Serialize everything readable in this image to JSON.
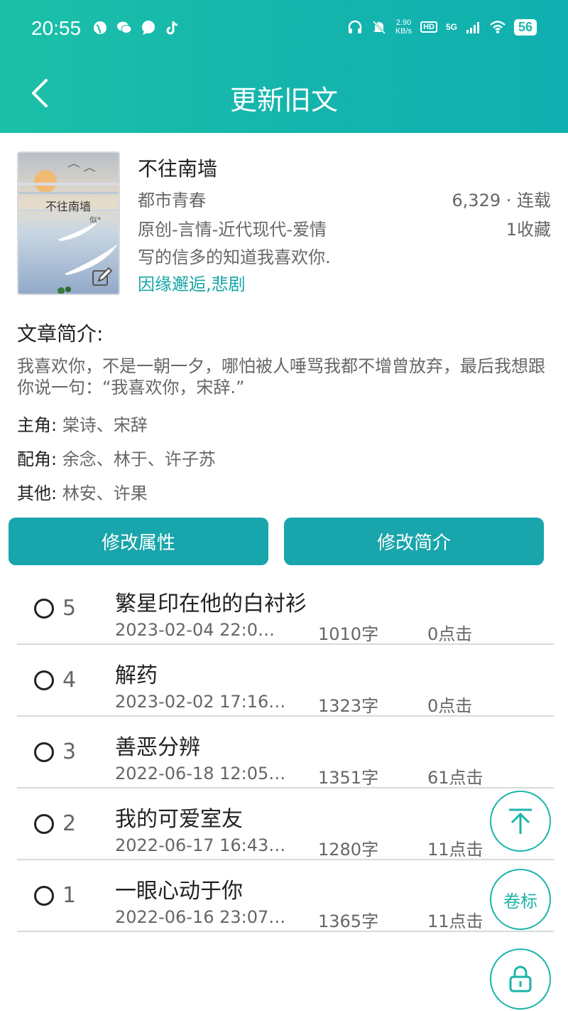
{
  "status_bar": {
    "time": "20:55",
    "net_speed_value": "2.90",
    "net_speed_unit": "KB/s",
    "hd": "HD",
    "signal": "5G",
    "battery": "56"
  },
  "header": {
    "title": "更新旧文"
  },
  "book": {
    "cover_title": "不往南墙",
    "cover_author": "似*",
    "title": "不往南墙",
    "genre": "都市青春",
    "tags": "原创-言情-近代现代-爱情",
    "description": "写的信多的知道我喜欢你.",
    "keywords": "因缘邂逅,悲剧",
    "word_status": "6,329 · 连载",
    "favorites": "1收藏"
  },
  "intro": {
    "heading": "文章简介:",
    "text": "我喜欢你，不是一朝一夕，哪怕被人唾骂我都不增曾放弃，最后我想跟你说一句：“我喜欢你，宋辞.”",
    "roles": [
      {
        "label": "主角:",
        "value": "棠诗、宋辞"
      },
      {
        "label": "配角:",
        "value": "余念、林于、许子苏"
      },
      {
        "label": "其他:",
        "value": "林安、许果"
      }
    ]
  },
  "actions": {
    "edit_attributes": "修改属性",
    "edit_intro": "修改简介"
  },
  "chapters": [
    {
      "num": "5",
      "title": "繁星印在他的白衬衫",
      "date": "2023-02-04 22:0…",
      "words": "1010字",
      "clicks": "0点击"
    },
    {
      "num": "4",
      "title": "解药",
      "date": "2023-02-02 17:16…",
      "words": "1323字",
      "clicks": "0点击"
    },
    {
      "num": "3",
      "title": "善恶分辨",
      "date": "2022-06-18 12:05…",
      "words": "1351字",
      "clicks": "61点击"
    },
    {
      "num": "2",
      "title": "我的可爱室友",
      "date": "2022-06-17 16:43…",
      "words": "1280字",
      "clicks": "11点击"
    },
    {
      "num": "1",
      "title": "一眼心动于你",
      "date": "2022-06-16 23:07…",
      "words": "1365字",
      "clicks": "11点击"
    }
  ],
  "fabs": {
    "volume_label": "卷标"
  },
  "colors": {
    "header_start": "#1cc0a8",
    "header_end": "#10b0b0",
    "accent": "#18a5ab",
    "keyword": "#17a6a6"
  },
  "icons": {
    "back": "chevron-left-icon",
    "top": "scroll-to-top-icon",
    "lock": "lock-icon",
    "edit": "edit-icon"
  }
}
